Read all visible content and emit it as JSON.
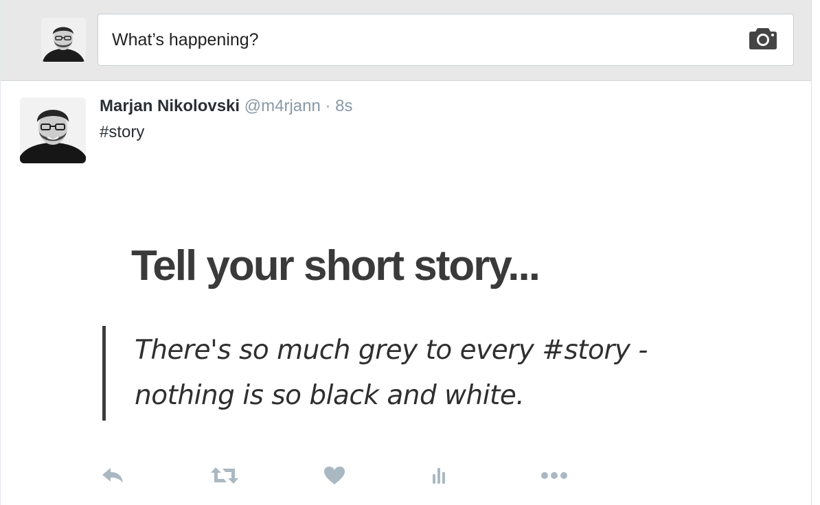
{
  "composer": {
    "placeholder": "What’s happening?",
    "avatar_icon": "user-avatar",
    "camera_icon": "camera-icon"
  },
  "tweet": {
    "author_name": "Marjan Nikolovski",
    "handle": "@m4rjann",
    "separator": "·",
    "time": "8s",
    "text": "#story",
    "card": {
      "title": "Tell your short story...",
      "quote": "There's so much grey to every #story - nothing is so black and white."
    },
    "actions": [
      {
        "name": "reply",
        "icon": "reply-icon"
      },
      {
        "name": "retweet",
        "icon": "retweet-icon"
      },
      {
        "name": "like",
        "icon": "heart-icon"
      },
      {
        "name": "analytics",
        "icon": "analytics-icon"
      },
      {
        "name": "more",
        "icon": "more-icon"
      }
    ]
  },
  "colors": {
    "composer_bg": "#e8e8e8",
    "name": "#292f33",
    "meta": "#8899a6",
    "action_icon": "#aab8c2"
  }
}
